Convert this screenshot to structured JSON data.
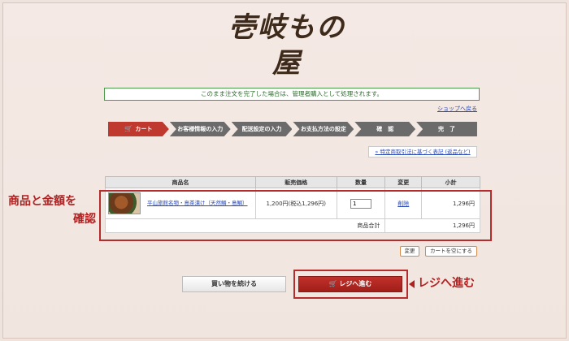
{
  "logo": {
    "text": "壱岐もの屋"
  },
  "notice": "このまま注文を完了した場合は、管理者購入として処理されます。",
  "shop_back": "ショップへ戻る",
  "steps": [
    {
      "label": "カート",
      "icon": "cart-icon",
      "active": true
    },
    {
      "label": "お客様情報の入力",
      "active": false
    },
    {
      "label": "配送設定の入力",
      "active": false
    },
    {
      "label": "お支払方法の設定",
      "active": false
    },
    {
      "label": "確　認",
      "active": false
    },
    {
      "label": "完　了",
      "active": false
    }
  ],
  "law_link": "» 特定商取引法に基づく表記 (返品など)",
  "table": {
    "headers": [
      "商品名",
      "販売価格",
      "数量",
      "変更",
      "小計"
    ],
    "row": {
      "name": "平山旅館名物・島茶漬け（天然鯛・島鯛）",
      "price": "1,200円(税込1,296円)",
      "qty": "1",
      "change": "削除",
      "subtotal": "1,296円"
    },
    "total_label": "商品合計",
    "total_value": "1,296円"
  },
  "buttons": {
    "update": "変更",
    "clear": "カートを空にする",
    "continue": "買い物を続ける",
    "checkout": "レジへ進む"
  },
  "annotations": {
    "confirm_line1": "商品と金額を",
    "confirm_line2": "確認",
    "checkout": "レジへ進む"
  },
  "colors": {
    "accent": "#c0392f",
    "annotation": "#b02020",
    "step_inactive": "#6b6b6b"
  }
}
